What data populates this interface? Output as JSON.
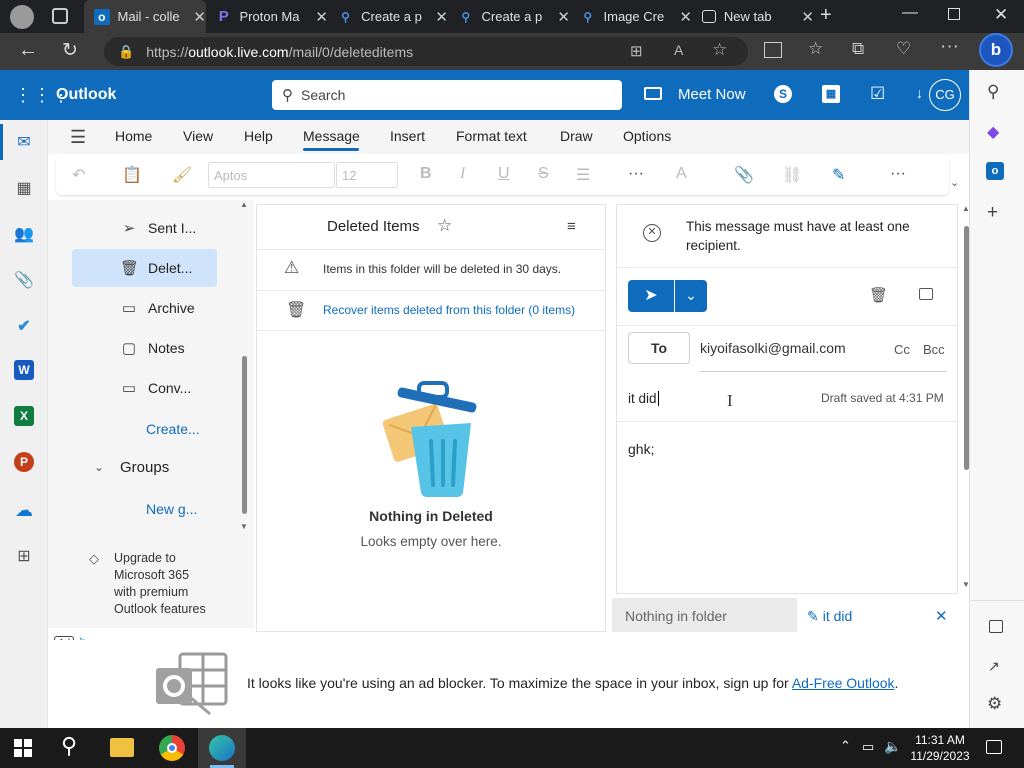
{
  "browser": {
    "tabs": [
      {
        "icon": "outlook-icon",
        "title": "Mail - colle",
        "active": true
      },
      {
        "icon": "proton-icon",
        "title": "Proton Ma",
        "active": false
      },
      {
        "icon": "search-icon",
        "title": "Create a p",
        "active": false
      },
      {
        "icon": "search-icon",
        "title": "Create a p",
        "active": false
      },
      {
        "icon": "search-icon",
        "title": "Image Cre",
        "active": false
      },
      {
        "icon": "newtab-icon",
        "title": "New tab",
        "active": false
      }
    ],
    "url_prefix": "https://",
    "url_host": "outlook.live.com",
    "url_path": "/mail/0/deleteditems"
  },
  "header": {
    "app_name": "Outlook",
    "search_placeholder": "Search",
    "meet_now": "Meet Now",
    "avatar_initials": "CG"
  },
  "ribbon": {
    "tabs": [
      "Home",
      "View",
      "Help",
      "Message",
      "Insert",
      "Format text",
      "Draw",
      "Options"
    ],
    "active_tab": "Message",
    "font_name": "Aptos",
    "font_size": "12"
  },
  "folders": {
    "items": [
      {
        "icon": "send-icon",
        "label": "Sent I..."
      },
      {
        "icon": "trash-icon",
        "label": "Delet...",
        "selected": true
      },
      {
        "icon": "archive-icon",
        "label": "Archive"
      },
      {
        "icon": "notes-icon",
        "label": "Notes"
      },
      {
        "icon": "folder-icon",
        "label": "Conv..."
      }
    ],
    "create_link": "Create...",
    "groups_label": "Groups",
    "new_group_link": "New g...",
    "upgrade_text": [
      "Upgrade to",
      "Microsoft 365",
      "with premium",
      "Outlook features"
    ],
    "ad_label": "Ad"
  },
  "list": {
    "title": "Deleted Items",
    "notice": "Items in this folder will be deleted in 30 days.",
    "recover": "Recover items deleted from this folder (0 items)",
    "empty_title": "Nothing in Deleted",
    "empty_sub": "Looks empty over here."
  },
  "compose": {
    "error": "This message must have at least one recipient.",
    "to_label": "To",
    "recipient": "kiyoifasolki@gmail.com",
    "cc": "Cc",
    "bcc": "Bcc",
    "subject": "it did",
    "draft_status": "Draft saved at 4:31 PM",
    "body": "ghk;"
  },
  "bottom_tabs": {
    "left": "Nothing in folder",
    "right": "it did"
  },
  "adblock": {
    "message": "It looks like you're using an ad blocker. To maximize the space in your inbox, sign up for ",
    "link": "Ad-Free Outlook",
    "end": "."
  },
  "taskbar": {
    "time": "11:31 AM",
    "date": "11/29/2023"
  },
  "colors": {
    "brand": "#0f6cbd",
    "selected_folder": "#cfe4fa"
  }
}
